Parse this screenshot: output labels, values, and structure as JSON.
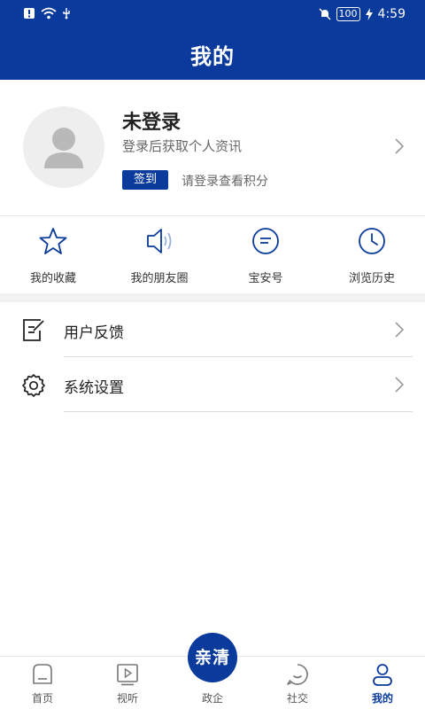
{
  "status_bar": {
    "battery": "100",
    "time": "4:59"
  },
  "header": {
    "title": "我的"
  },
  "profile": {
    "name": "未登录",
    "subtitle": "登录后获取个人资讯",
    "signin_label": "签到",
    "points_hint": "请登录查看积分"
  },
  "quick_actions": [
    {
      "label": "我的收藏",
      "icon": "star-icon"
    },
    {
      "label": "我的朋友圈",
      "icon": "speaker-icon"
    },
    {
      "label": "宝安号",
      "icon": "chat-icon"
    },
    {
      "label": "浏览历史",
      "icon": "clock-icon"
    }
  ],
  "menu": [
    {
      "label": "用户反馈",
      "icon": "feedback-icon"
    },
    {
      "label": "系统设置",
      "icon": "gear-icon"
    }
  ],
  "tabbar": {
    "center_label": "亲清",
    "tabs": [
      {
        "label": "首页",
        "icon": "home-icon"
      },
      {
        "label": "视听",
        "icon": "video-icon"
      },
      {
        "label": "政企",
        "icon": "center-logo"
      },
      {
        "label": "社交",
        "icon": "social-icon"
      },
      {
        "label": "我的",
        "icon": "user-icon"
      }
    ],
    "active_tab": "我的"
  },
  "colors": {
    "brand": "#0a3a9c",
    "background": "#ffffff",
    "divider": "#f2f2f2"
  }
}
